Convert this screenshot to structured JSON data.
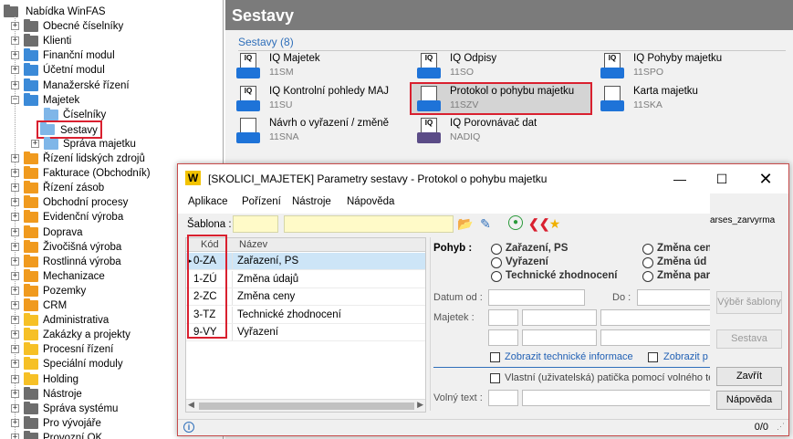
{
  "tree": {
    "root": "Nabídka WinFAS",
    "items": [
      {
        "label": "Obecné číselníky",
        "color": "gray"
      },
      {
        "label": "Klienti",
        "color": "gray"
      },
      {
        "label": "Finanční modul",
        "color": "blue"
      },
      {
        "label": "Účetní modul",
        "color": "blue"
      },
      {
        "label": "Manažerské řízení",
        "color": "blue"
      },
      {
        "label": "Majetek",
        "color": "blue"
      },
      {
        "label": "Číselníky",
        "color": "light"
      },
      {
        "label": "Sestavy",
        "color": "light"
      },
      {
        "label": "Správa majetku",
        "color": "light"
      },
      {
        "label": "Řízení lidských zdrojů",
        "color": "orange"
      },
      {
        "label": "Fakturace (Obchodník)",
        "color": "orange"
      },
      {
        "label": "Řízení zásob",
        "color": "orange"
      },
      {
        "label": "Obchodní procesy",
        "color": "orange"
      },
      {
        "label": "Evidenční výroba",
        "color": "orange"
      },
      {
        "label": "Doprava",
        "color": "orange"
      },
      {
        "label": "Živočišná výroba",
        "color": "orange"
      },
      {
        "label": "Rostlinná výroba",
        "color": "orange"
      },
      {
        "label": "Mechanizace",
        "color": "orange"
      },
      {
        "label": "Pozemky",
        "color": "orange"
      },
      {
        "label": "CRM",
        "color": "orange"
      },
      {
        "label": "Administrativa",
        "color": "yellow"
      },
      {
        "label": "Zakázky a projekty",
        "color": "yellow"
      },
      {
        "label": "Procesní řízení",
        "color": "yellow"
      },
      {
        "label": "Speciální moduly",
        "color": "yellow"
      },
      {
        "label": "Holding",
        "color": "yellow"
      },
      {
        "label": "Nástroje",
        "color": "gray"
      },
      {
        "label": "Správa systému",
        "color": "gray"
      },
      {
        "label": "Pro vývojáře",
        "color": "gray"
      },
      {
        "label": "Provozní OK",
        "color": "gray"
      }
    ]
  },
  "panel": {
    "title": "Sestavy",
    "section": "Sestavy (8)",
    "reports": [
      {
        "name": "IQ Majetek",
        "code": "11SM"
      },
      {
        "name": "IQ Odpisy",
        "code": "11SO"
      },
      {
        "name": "IQ Pohyby majetku",
        "code": "11SPO"
      },
      {
        "name": "IQ Kontrolní pohledy MAJ",
        "code": "11SU"
      },
      {
        "name": "Protokol o pohybu majetku",
        "code": "11SZV"
      },
      {
        "name": "Karta majetku",
        "code": "11SKA"
      },
      {
        "name": "Návrh o vyřazení / změně",
        "code": "11SNA"
      },
      {
        "name": "IQ Porovnávač dat",
        "code": "NADIQ"
      }
    ]
  },
  "dialog": {
    "title": "[SKOLICI_MAJETEK] Parametry sestavy - Protokol o pohybu majetku",
    "logo": "W",
    "menu": [
      "Aplikace",
      "Pořízení",
      "Nástroje",
      "Nápověda"
    ],
    "sablona_label": "Šablona :",
    "grid": {
      "col_code": "Kód",
      "col_name": "Název",
      "rows": [
        {
          "code": "0-ZA",
          "name": "Zařazení, PS"
        },
        {
          "code": "1-ZÚ",
          "name": "Změna údajů"
        },
        {
          "code": "2-ZC",
          "name": "Změna ceny"
        },
        {
          "code": "3-TZ",
          "name": "Technické zhodnocení"
        },
        {
          "code": "9-VY",
          "name": "Vyřazení"
        }
      ]
    },
    "pohyb_label": "Pohyb :",
    "radios": [
      "Zařazení, PS",
      "Vyřazení",
      "Technické zhodnocení",
      "Změna cen",
      "Změna úd",
      "Změna par"
    ],
    "datum_label": "Datum od :",
    "do_label": "Do :",
    "majetek_label": "Majetek :",
    "chk_tech": "Zobrazit technické informace",
    "chk_zobrazit": "Zobrazit p",
    "chk_paticka": "Vlastní (uživatelská) patička pomocí volného tex",
    "volny_label": "Volný text :",
    "side_text": "arses_zarvyrma",
    "buttons": {
      "vyber": "Výběr šablony",
      "sestava": "Sestava",
      "zavrit": "Zavřít",
      "napoveda": "Nápověda"
    },
    "count": "0/0"
  },
  "colors": {
    "accent_red": "#d9202f",
    "header_gray": "#7b7b7b",
    "link_blue": "#2f6fba"
  }
}
